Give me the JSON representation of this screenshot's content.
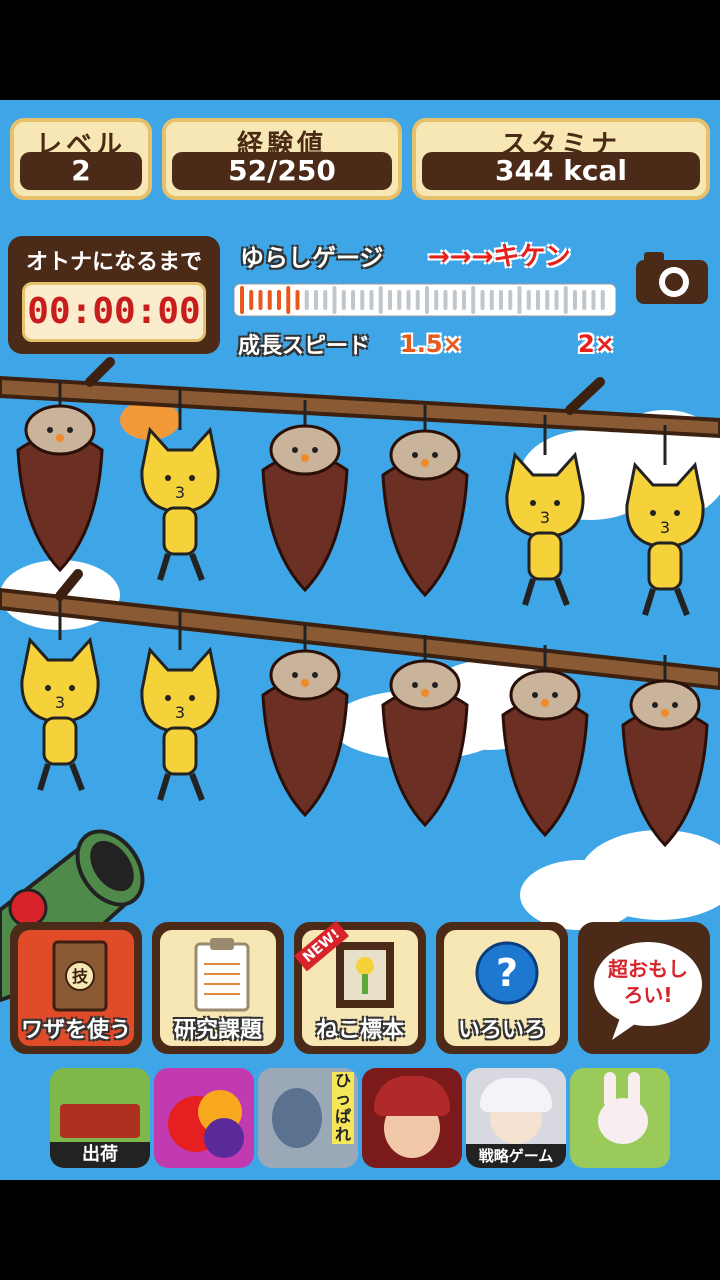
{
  "stats": {
    "level_label": "レベル",
    "level_value": "2",
    "exp_label": "経験値",
    "exp_value": "52/250",
    "stamina_label": "スタミナ",
    "stamina_value": "344  kcal"
  },
  "timer": {
    "label": "オトナになるまで",
    "value": "00:00:00"
  },
  "gauge": {
    "label": "ゆらしゲージ",
    "danger_label": "→→→キケン",
    "fill_ticks": 7,
    "total_ticks": 40,
    "speed_label": "成長スピード",
    "speed_low": "1.5×",
    "speed_high": "2×"
  },
  "menu": {
    "skill": "ワザを使う",
    "research": "研究課題",
    "specimen": "ねこ標本",
    "specimen_badge": "NEW!",
    "misc": "いろいろ",
    "promo": "超おもしろい!"
  },
  "ads": {
    "farm_caption": "出荷",
    "pull_caption": "ひっぱれ",
    "strategy_caption": "戦略ゲーム"
  },
  "colors": {
    "sky": "#3ea6e6",
    "wood_dark": "#4b2a17",
    "panel": "#f7e7b4",
    "danger": "#e6211b"
  },
  "icons": [
    "camera-icon",
    "skill-book-icon",
    "clipboard-icon",
    "specimen-frame-icon",
    "question-icon",
    "speech-bubble-icon",
    "cannon-icon"
  ]
}
